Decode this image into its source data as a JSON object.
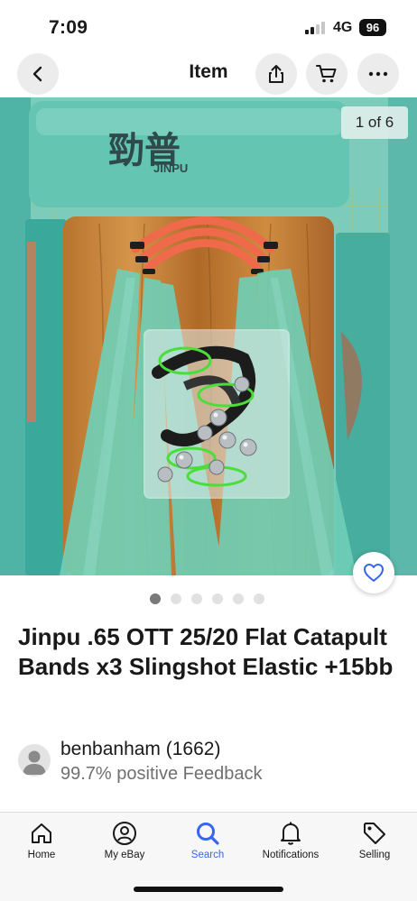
{
  "status_bar": {
    "time": "7:09",
    "network": "4G",
    "battery": "96"
  },
  "nav": {
    "title": "Item",
    "icons": [
      "back-arrow-icon",
      "share-icon",
      "cart-icon",
      "more-icon"
    ]
  },
  "gallery": {
    "counter": "1 of 6",
    "total_images": 6,
    "active_index": 0,
    "brand_text": "JINPU"
  },
  "item": {
    "title": "Jinpu .65 OTT 25/20 Flat Catapult Bands x3 Slingshot Elastic +15bb"
  },
  "seller": {
    "name": "benbanham (1662)",
    "feedback": "99.7% positive Feedback"
  },
  "tabs": [
    {
      "label": "Home",
      "icon": "home-icon"
    },
    {
      "label": "My eBay",
      "icon": "user-icon"
    },
    {
      "label": "Search",
      "icon": "search-icon",
      "active": true
    },
    {
      "label": "Notifications",
      "icon": "bell-icon"
    },
    {
      "label": "Selling",
      "icon": "tag-icon"
    }
  ],
  "colors": {
    "accent": "#3665f3",
    "text": "#191919",
    "muted": "#707070"
  }
}
